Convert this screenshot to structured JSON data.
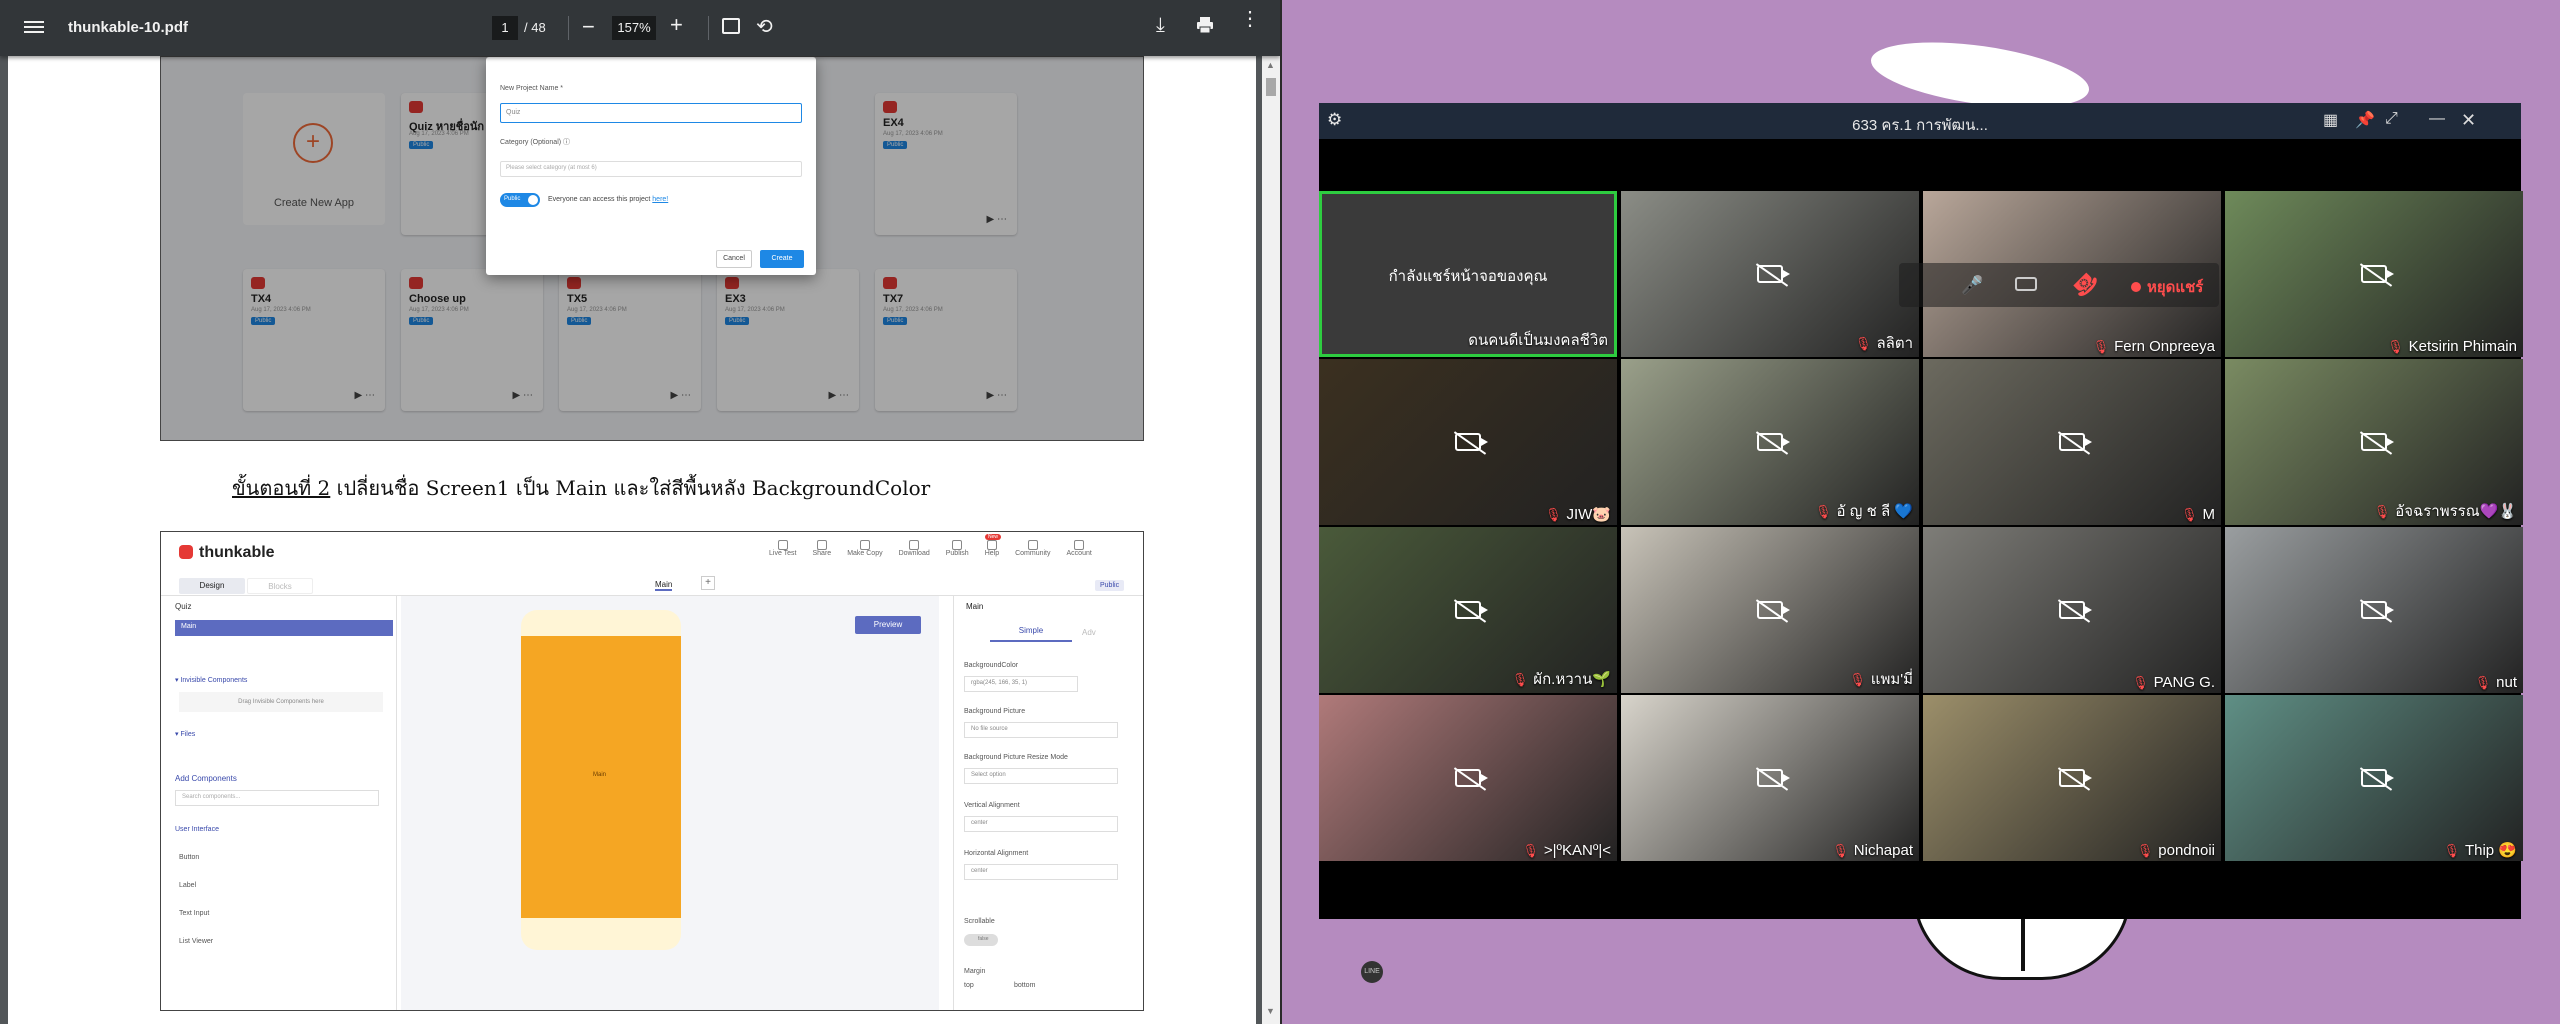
{
  "pdf": {
    "filename": "thunkable-10.pdf",
    "page_current": "1",
    "page_total": "/ 48",
    "zoom": "157%"
  },
  "shot1": {
    "create_new_app": "Create New App",
    "cards": [
      {
        "name": "Quiz หายชื่อนัก",
        "date": "Aug 17, 2023 4:06 PM",
        "badge": "Public"
      },
      {
        "name": "EX4",
        "date": "Aug 17, 2023 4:06 PM",
        "badge": "Public"
      },
      {
        "name": "TX4",
        "date": "Aug 17, 2023 4:06 PM",
        "badge": "Public"
      },
      {
        "name": "Choose up",
        "date": "Aug 17, 2023 4:06 PM",
        "badge": "Public"
      },
      {
        "name": "TX5",
        "date": "Aug 17, 2023 4:06 PM",
        "badge": "Public"
      },
      {
        "name": "EX3",
        "date": "Aug 17, 2023 4:06 PM",
        "badge": "Public"
      },
      {
        "name": "TX7",
        "date": "Aug 17, 2023 4:06 PM",
        "badge": "Public"
      }
    ],
    "dialog": {
      "project_name_label": "New Project Name *",
      "project_name_value": "Quiz",
      "category_label": "Category (Optional) ⓘ",
      "category_placeholder": "Please select category (at most 6)",
      "toggle_label": "Public",
      "access_text": "Everyone can access this project",
      "here_link": "here!",
      "cancel": "Cancel",
      "create": "Create"
    }
  },
  "step2": {
    "step_label": "ขั้นตอนที่ 2",
    "text": " เปลี่ยนชื่อ Screen1 เป็น Main และใส่สีพื้นหลัง BackgroundColor"
  },
  "shot2": {
    "logo": "thunkable",
    "nav": [
      "Live Test",
      "Share",
      "Make Copy",
      "Download",
      "Publish",
      "Help",
      "Community",
      "Account"
    ],
    "new_badge": "New",
    "tab_design": "Design",
    "tab_blocks": "Blocks",
    "screen_tab": "Main",
    "public_badge": "Public",
    "project": "Quiz",
    "screen_item": "Main",
    "invisible": "▾ Invisible Components",
    "drag_here": "Drag Invisible Components here",
    "files": "▾ Files",
    "add_components": "Add Components",
    "search_placeholder": "Search components...",
    "user_interface": "User Interface",
    "components": [
      "Button",
      "Label",
      "Text Input",
      "List Viewer"
    ],
    "phone_label": "Main",
    "preview": "Preview",
    "props_title": "Main",
    "tab_simple": "Simple",
    "tab_advanced": "Adv",
    "bg_color_label": "BackgroundColor",
    "bg_color_value": "rgba(245, 166, 35, 1)",
    "bg_picture_label": "Background Picture",
    "bg_picture_value": "No file source",
    "resize_label": "Background Picture Resize Mode",
    "resize_value": "Select option",
    "valign_label": "Vertical Alignment",
    "valign_value": "center",
    "halign_label": "Horizontal Alignment",
    "halign_value": "center",
    "scrollable_label": "Scrollable",
    "scrollable_value": "false",
    "margin_label": "Margin",
    "margin_top": "top",
    "margin_bottom": "bottom"
  },
  "meeting": {
    "title": "633 คร.1 การพัฒน...",
    "sharing_text": "กำลังแชร์หน้าจอของคุณ",
    "controls": {
      "stop_share": "หยุดแชร์"
    },
    "participants": [
      {
        "name": "ดนคนดีเป็นมงคลชีวิต",
        "muted": false,
        "video": "share"
      },
      {
        "name": "ลลิตา",
        "muted": true,
        "video": "off"
      },
      {
        "name": "Fern Onpreeya",
        "muted": true,
        "video": "on"
      },
      {
        "name": "Ketsirin Phimain",
        "muted": true,
        "video": "off"
      },
      {
        "name": "JIW🐷",
        "muted": true,
        "video": "off"
      },
      {
        "name": "อั ญ ช ลี 💙",
        "muted": true,
        "video": "off"
      },
      {
        "name": "M",
        "muted": true,
        "video": "off"
      },
      {
        "name": "อัจฉราพรรณ💜🐰",
        "muted": true,
        "video": "off"
      },
      {
        "name": "ผัก.หวาน🌱",
        "muted": true,
        "video": "off"
      },
      {
        "name": "แพม'มี่",
        "muted": true,
        "video": "off"
      },
      {
        "name": "PANG G.",
        "muted": true,
        "video": "off"
      },
      {
        "name": "nut",
        "muted": true,
        "video": "off"
      },
      {
        "name": ">|ºKANº|<",
        "muted": true,
        "video": "off"
      },
      {
        "name": "Nichapat",
        "muted": true,
        "video": "off"
      },
      {
        "name": "pondnoii",
        "muted": true,
        "video": "off"
      },
      {
        "name": "Thip 😍",
        "muted": true,
        "video": "off"
      }
    ],
    "logo": "LINE"
  },
  "colors": {
    "pdf_toolbar": "#323639",
    "meeting_bar": "#1f2a3a",
    "share_border": "#2ecc40",
    "muted_icon": "#ff4d4d",
    "thunkable_accent": "#5c6bc0",
    "bg_color_sample": "#f5a623"
  }
}
